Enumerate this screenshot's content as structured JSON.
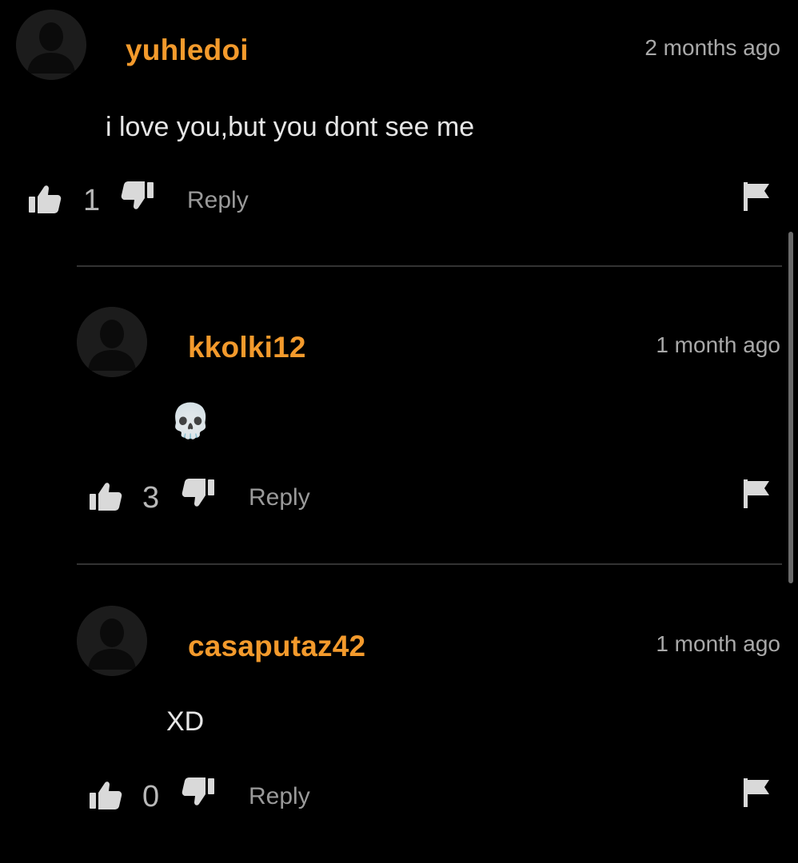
{
  "theme": {
    "username_color": "#f39a2c",
    "background": "#000000",
    "icon_color": "#d9d9d9"
  },
  "comments": [
    {
      "username": "yuhledoi",
      "timestamp": "2 months ago",
      "text": "i love you,but you dont see me",
      "likes": "1",
      "reply_label": "Reply"
    },
    {
      "username": "kkolki12",
      "timestamp": "1 month ago",
      "text": "💀",
      "likes": "3",
      "reply_label": "Reply"
    },
    {
      "username": "casaputaz42",
      "timestamp": "1 month ago",
      "text": "XD",
      "likes": "0",
      "reply_label": "Reply"
    }
  ],
  "icons": {
    "avatar": "default-user-avatar-icon",
    "like": "thumbs-up-icon",
    "dislike": "thumbs-down-icon",
    "report": "flag-icon"
  }
}
